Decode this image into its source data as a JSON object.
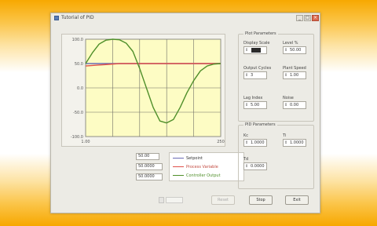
{
  "window": {
    "title": "Tutorial of PID",
    "controls": {
      "minimize": "_",
      "maximize": "□",
      "close": "×"
    }
  },
  "plot_params": {
    "title": "Plot Parameters",
    "fields": [
      {
        "label": "Display Scale",
        "value": "",
        "icon": "spin-arrows"
      },
      {
        "label": "Level %",
        "value": "50.00",
        "icon": "spin-arrows"
      },
      {
        "label": "Output Cycles",
        "value": "3",
        "icon": "spin-arrows"
      },
      {
        "label": "Plant Speed",
        "value": "1.00",
        "icon": "spin-arrows"
      },
      {
        "label": "Lag Index",
        "value": "5.00",
        "icon": "spin-arrows"
      },
      {
        "label": "Noise",
        "value": "0.00",
        "icon": "spin-arrows"
      }
    ]
  },
  "pid_params": {
    "title": "PID Parameters",
    "fields": [
      {
        "label": "Kc",
        "value": "1.0000",
        "icon": "spin-arrows"
      },
      {
        "label": "Ti",
        "value": "1.0000",
        "icon": "spin-arrows"
      },
      {
        "label": "Td",
        "value": "0.0000",
        "icon": "spin-arrows"
      }
    ]
  },
  "legend": {
    "values": [
      "50.00",
      "50.0000",
      "50.0000"
    ],
    "items": [
      {
        "label": "Setpoint",
        "color": "#6b6bb4"
      },
      {
        "label": "Process Variable",
        "color": "#e0504a"
      },
      {
        "label": "Controller Output",
        "color": "#4f8f2a"
      }
    ]
  },
  "buttons": {
    "reset": "Reset",
    "stop": "Stop",
    "exit": "Exit"
  },
  "chart_data": {
    "type": "line",
    "x": [
      0,
      0.05,
      0.1,
      0.15,
      0.2,
      0.25,
      0.3,
      0.35,
      0.4,
      0.45,
      0.5,
      0.55,
      0.6,
      0.65,
      0.7,
      0.75,
      0.8,
      0.85,
      0.9,
      0.95,
      1.0
    ],
    "series": [
      {
        "name": "Setpoint",
        "color": "#6b6bb4",
        "values": [
          50,
          50,
          50,
          50,
          50,
          50,
          50,
          50,
          50,
          50,
          50,
          50,
          50,
          50,
          50,
          50,
          50,
          50,
          50,
          50,
          50
        ]
      },
      {
        "name": "Process Variable",
        "color": "#e0504a",
        "values": [
          45,
          46,
          47,
          48,
          49,
          50,
          50,
          50,
          50,
          50,
          50,
          50,
          50,
          50,
          50,
          50,
          50,
          50,
          50,
          50,
          50
        ]
      },
      {
        "name": "Controller Output",
        "color": "#4f8f2a",
        "values": [
          50,
          72,
          90,
          98,
          100,
          99,
          92,
          75,
          40,
          0,
          -40,
          -68,
          -72,
          -65,
          -40,
          -10,
          15,
          35,
          45,
          49,
          50
        ]
      }
    ],
    "ylim": [
      -100,
      100
    ],
    "y_ticks": [
      "100.0",
      "50.0",
      "0.0",
      "-50.0",
      "-100.0"
    ],
    "x_ticks": [
      "1.00",
      "250"
    ],
    "grid": true
  }
}
